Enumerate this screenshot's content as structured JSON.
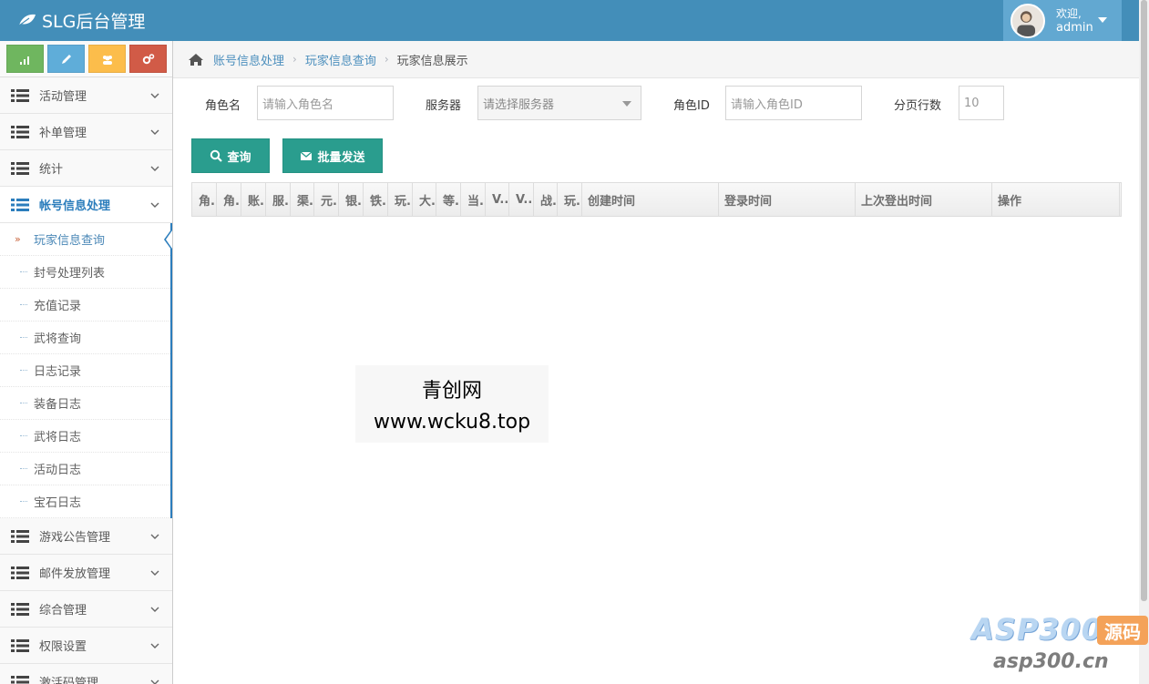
{
  "app": {
    "title": "SLG后台管理"
  },
  "user": {
    "welcome": "欢迎,",
    "name": "admin"
  },
  "shortcuts": [
    {
      "icon": "signal-icon",
      "color": "#6fb65f"
    },
    {
      "icon": "pencil-icon",
      "color": "#5fadd9"
    },
    {
      "icon": "users-icon",
      "color": "#fcbd4b"
    },
    {
      "icon": "cogs-icon",
      "color": "#d15b47"
    }
  ],
  "sidebar": {
    "top_items": [
      {
        "label": "活动管理"
      },
      {
        "label": "补单管理"
      },
      {
        "label": "统计"
      },
      {
        "label": "帐号信息处理",
        "active": true
      }
    ],
    "sub_items": [
      {
        "label": "玩家信息查询",
        "active": true
      },
      {
        "label": "封号处理列表"
      },
      {
        "label": "充值记录"
      },
      {
        "label": "武将查询"
      },
      {
        "label": "日志记录"
      },
      {
        "label": "装备日志"
      },
      {
        "label": "武将日志"
      },
      {
        "label": "活动日志"
      },
      {
        "label": "宝石日志"
      }
    ],
    "bottom_items": [
      {
        "label": "游戏公告管理"
      },
      {
        "label": "邮件发放管理"
      },
      {
        "label": "综合管理"
      },
      {
        "label": "权限设置"
      },
      {
        "label": "激活码管理"
      }
    ]
  },
  "breadcrumb": {
    "level1": "账号信息处理",
    "level2": "玩家信息查询",
    "current": "玩家信息展示"
  },
  "form": {
    "role_name": {
      "label": "角色名",
      "placeholder": "请输入角色名"
    },
    "server": {
      "label": "服务器",
      "placeholder": "请选择服务器"
    },
    "role_id": {
      "label": "角色ID",
      "placeholder": "请输入角色ID"
    },
    "page_rows": {
      "label": "分页行数",
      "value": "10"
    }
  },
  "buttons": {
    "query": "查询",
    "batch_send": "批量发送"
  },
  "table": {
    "columns": [
      "角.",
      "角.",
      "账.",
      "服.",
      "渠.",
      "元.",
      "银.",
      "铁.",
      "玩.",
      "大.",
      "等.",
      "当.",
      "V..",
      "V..",
      "战.",
      "玩.",
      "创建时间",
      "登录时间",
      "上次登出时间",
      "操作"
    ]
  },
  "watermark": {
    "line1": "青创网",
    "line2": "www.wcku8.top"
  },
  "corner_logo": {
    "brand": "ASP300",
    "tag": "源码",
    "site": "asp300.cn"
  },
  "colors": {
    "navbar": "#438eb9",
    "button": "#2a9d8e",
    "link": "#4c8fbd"
  }
}
